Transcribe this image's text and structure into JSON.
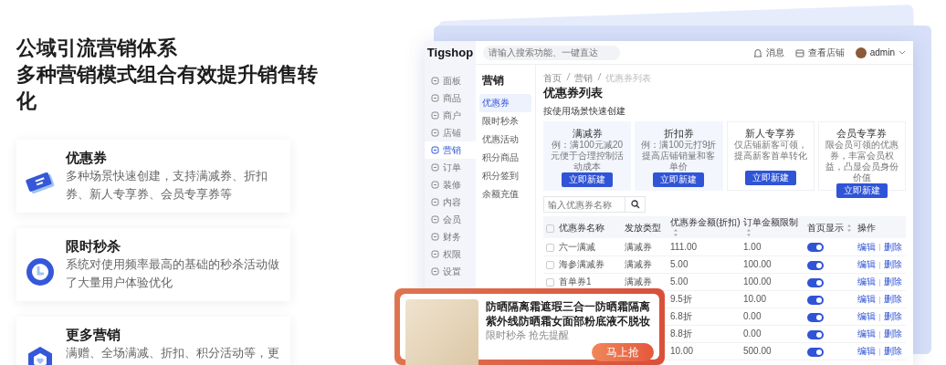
{
  "hero": {
    "title": "公域引流营销体系",
    "subtitle": "多种营销模式组合有效提升销售转化"
  },
  "features": [
    {
      "kind": "coupon",
      "title": "优惠券",
      "description": "多种场景快速创建，支持满减券、折扣券、新人专享券、会员专享券等"
    },
    {
      "kind": "clock",
      "title": "限时秒杀",
      "description": "系统对使用频率最高的基础的秒杀活动做了大量用户体验优化"
    },
    {
      "kind": "hexagon",
      "title": "更多营销",
      "description": "满赠、全场满减、折扣、积分活动等，更"
    }
  ],
  "app": {
    "logo": "Tigshop",
    "search_placeholder": "请输入搜索功能、一键直达",
    "header_links": [
      {
        "kind": "bell",
        "label": "消息"
      },
      {
        "kind": "store",
        "label": "查看店铺"
      }
    ],
    "user": {
      "name": "admin"
    },
    "sidebar": [
      {
        "label": "面板",
        "selected": false
      },
      {
        "label": "商品",
        "selected": false
      },
      {
        "label": "商户",
        "selected": false
      },
      {
        "label": "店铺",
        "selected": false
      },
      {
        "label": "营销",
        "selected": true
      },
      {
        "label": "订单",
        "selected": false
      },
      {
        "label": "装修",
        "selected": false
      },
      {
        "label": "内容",
        "selected": false
      },
      {
        "label": "会员",
        "selected": false
      },
      {
        "label": "财务",
        "selected": false
      },
      {
        "label": "权限",
        "selected": false
      },
      {
        "label": "设置",
        "selected": false
      }
    ],
    "submenu": {
      "title": "营销",
      "items": [
        {
          "label": "优惠券",
          "selected": true
        },
        {
          "label": "限时秒杀",
          "selected": false
        },
        {
          "label": "优惠活动",
          "selected": false
        },
        {
          "label": "积分商品",
          "selected": false
        },
        {
          "label": "积分签到",
          "selected": false
        },
        {
          "label": "余额充值",
          "selected": false
        }
      ]
    },
    "breadcrumb": [
      "首页",
      "营销",
      "优惠券列表"
    ],
    "page_title": "优惠券列表",
    "section_title": "按使用场景快速创建",
    "coupon_types": [
      {
        "title": "满减券",
        "description": "例：满100元减20元便于合理控制活动成本",
        "button": "立即新建",
        "highlighted": true
      },
      {
        "title": "折扣券",
        "description": "例：满100元打9折提高店铺销量和客单价",
        "button": "立即新建",
        "highlighted": true
      },
      {
        "title": "新人专享券",
        "description": "仅店铺新客可领，提高新客首单转化",
        "button": "立即新建",
        "highlighted": false
      },
      {
        "title": "会员专享券",
        "description": "限会员可领的优惠券，丰富会员权益，凸显会员身份价值",
        "button": "立即新建",
        "highlighted": false
      }
    ],
    "table": {
      "search_placeholder": "输入优惠券名称",
      "header_checked": false,
      "columns": [
        {
          "label": "优惠券名称",
          "sortable": false
        },
        {
          "label": "发放类型",
          "sortable": false
        },
        {
          "label": "优惠券金额(折扣)",
          "sortable": true
        },
        {
          "label": "订单金额限制",
          "sortable": true
        },
        {
          "label": "首页显示",
          "sortable": true
        },
        {
          "label": "操作",
          "sortable": false
        }
      ],
      "rows": [
        {
          "checked": false,
          "name": "六一满减",
          "type": "满减券",
          "amount": "111.00",
          "limit": "1.00",
          "show_on_home": true,
          "actions": [
            "编辑",
            "删除"
          ]
        },
        {
          "checked": false,
          "name": "海参满减券",
          "type": "满减券",
          "amount": "5.00",
          "limit": "100.00",
          "show_on_home": true,
          "actions": [
            "编辑",
            "删除"
          ]
        },
        {
          "checked": false,
          "name": "首单券1",
          "type": "满减券",
          "amount": "5.00",
          "limit": "100.00",
          "show_on_home": true,
          "actions": [
            "编辑",
            "删除"
          ]
        },
        {
          "amount": "9.5折",
          "limit": "10.00",
          "show_on_home": true,
          "actions": [
            "编辑",
            "删除"
          ]
        },
        {
          "amount": "6.8折",
          "limit": "0.00",
          "show_on_home": true,
          "actions": [
            "编辑",
            "删除"
          ]
        },
        {
          "amount": "8.8折",
          "limit": "0.00",
          "show_on_home": true,
          "actions": [
            "编辑",
            "删除"
          ]
        },
        {
          "amount": "10.00",
          "limit": "500.00",
          "show_on_home": true,
          "actions": [
            "编辑",
            "删除"
          ]
        }
      ]
    }
  },
  "promo": {
    "title": "防晒隔离霜遮瑕三合一防晒霜隔离紫外线防晒霜女面部粉底液不脱妆",
    "subtitle": "限时秒杀 抢先提醒",
    "button": "马上抢"
  }
}
